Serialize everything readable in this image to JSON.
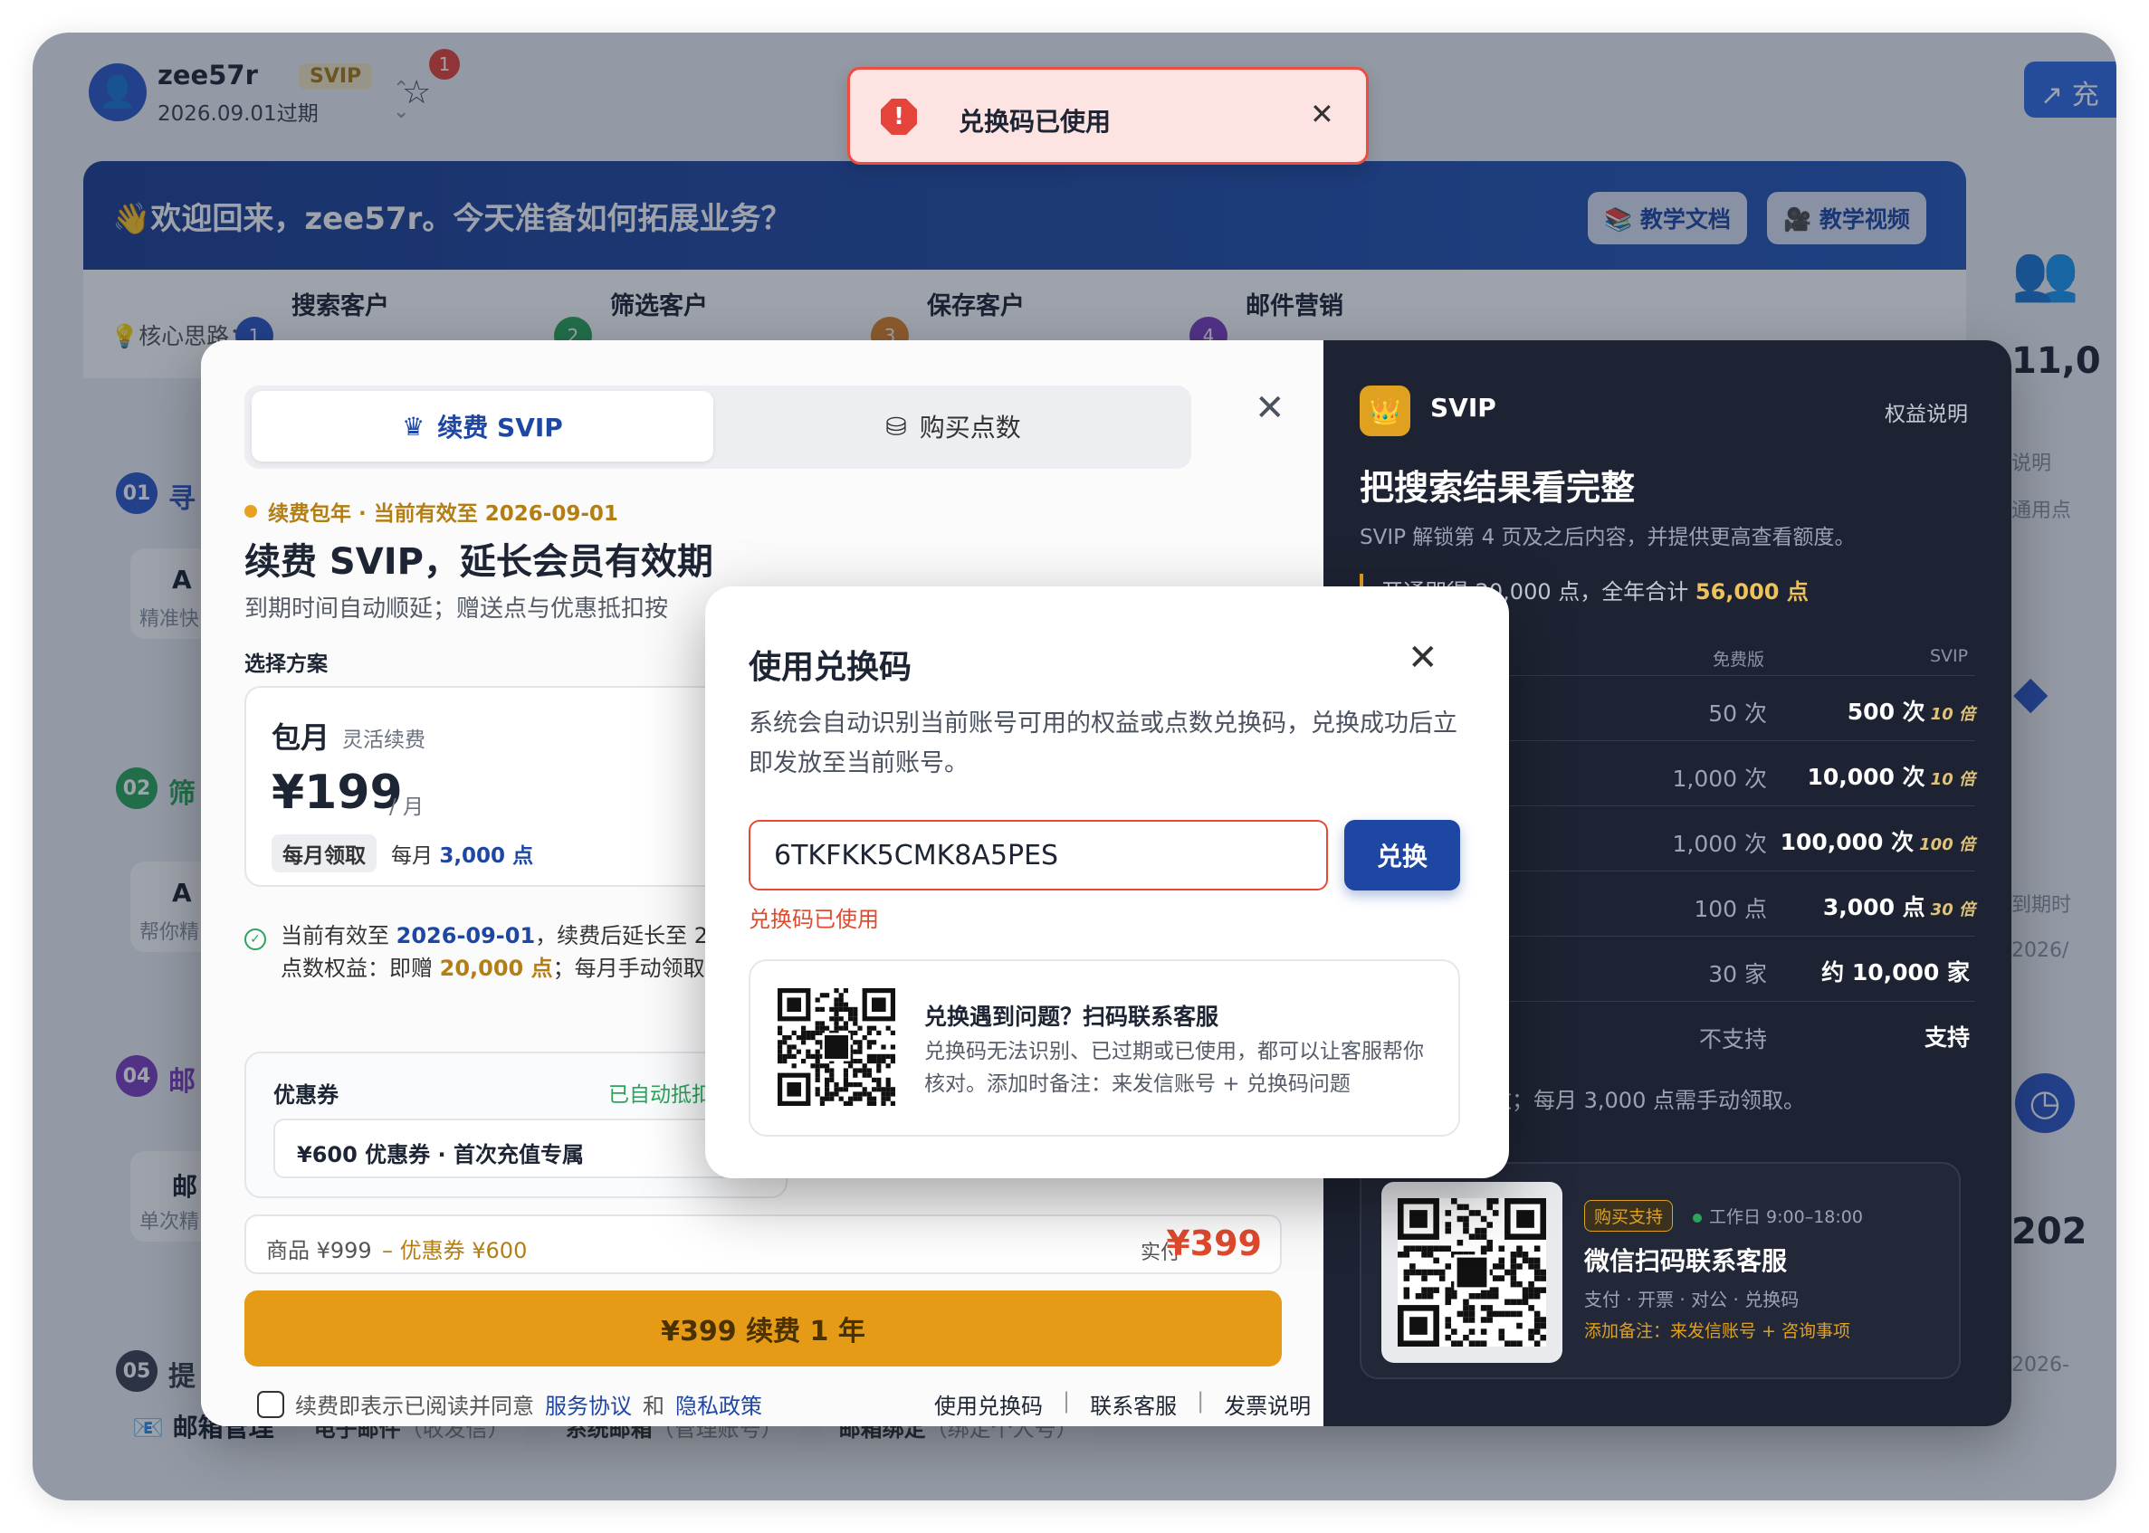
{
  "header": {
    "username": "zee57r",
    "tier": "SVIP",
    "expiry": "2026.09.01过期",
    "notification_count": "1",
    "top_button": "充"
  },
  "banner": {
    "welcome": "👋欢迎回来，zee57r。今天准备如何拓展业务？",
    "doc_button": "📚 教学文档",
    "video_button": "🎥 教学视频"
  },
  "core": {
    "label": "💡核心思路：",
    "steps": [
      {
        "num": "1",
        "label": "搜索客户",
        "color": "#2b56c9"
      },
      {
        "num": "2",
        "label": "筛选客户",
        "color": "#2aa55a"
      },
      {
        "num": "3",
        "label": "保存客户",
        "color": "#e0862a"
      },
      {
        "num": "4",
        "label": "邮件营销",
        "color": "#7a3fc2"
      }
    ]
  },
  "sections": [
    {
      "num": "01",
      "title": "寻",
      "color": "#2b56c9"
    },
    {
      "num": "02",
      "title": "筛",
      "color": "#2aa55a"
    },
    {
      "num": "04",
      "title": "邮",
      "color": "#7a3fc2"
    },
    {
      "num": "05",
      "title": "提",
      "color": "#3a4150"
    }
  ],
  "side_cards": [
    {
      "title": "A",
      "sub": "精准快"
    },
    {
      "title": "A",
      "sub": "帮你精"
    },
    {
      "title": "邮",
      "sub": "单次精"
    }
  ],
  "right_col": {
    "value1": "11,0",
    "label1": "说明",
    "label2": "通用点",
    "label3": "到期时",
    "value2": "2026/",
    "value3": "202",
    "value4": "2026-"
  },
  "mailbar": {
    "title": "📧 邮箱管理",
    "tabs": [
      {
        "label": "电子邮件",
        "sub": "（收发信）"
      },
      {
        "label": "系统邮箱",
        "sub": "（管理账号）"
      },
      {
        "label": "邮箱绑定",
        "sub": "（绑定个人号）"
      }
    ]
  },
  "renewal": {
    "tab_svip": "续费 SVIP",
    "tab_points": "购买点数",
    "status": "续费包年 · 当前有效至 2026-09-01",
    "title": "续费 SVIP，延长会员有效期",
    "subtitle": "到期时间自动顺延；赠送点与优惠抵扣按",
    "plan_label": "选择方案",
    "plan": {
      "name": "包月",
      "tag": "灵活续费",
      "price": "¥199",
      "unit": "/ 月",
      "pill": "每月领取",
      "points_prefix": "每月",
      "points": "3,000 点"
    },
    "info_line1_prefix": "当前有效至",
    "info_line1_date": "2026-09-01",
    "info_line1_suffix": "，续费后延长至 2",
    "info_line2_prefix": "点数权益：即赠",
    "info_line2_points": "20,000 点",
    "info_line2_suffix": "；每月手动领取",
    "coupon_label": "优惠券",
    "coupon_auto": "已自动抵扣",
    "coupon_value": "¥600 优惠券 · 首次充值专属",
    "goods": "商品 ¥999",
    "discount": "– 优惠券 ¥600",
    "real_label": "实付",
    "real_price": "¥399",
    "pay_button": "¥399 续费 1 年",
    "agree_text": "续费即表示已阅读并同意",
    "agree_terms": "服务协议",
    "agree_and": "和",
    "agree_privacy": "隐私政策",
    "link_redeem": "使用兑换码",
    "link_service": "联系客服",
    "link_invoice": "发票说明"
  },
  "svip_panel": {
    "brand": "SVIP",
    "rights_link": "权益说明",
    "headline": "把搜索结果看完整",
    "desc": "SVIP 解锁第 4 页及之后内容，并提供更高查看额度。",
    "total_prefix": "开通即得 20,000 点，全年合计",
    "total_value": "56,000 点",
    "col_free": "免费版",
    "col_svip": "SVIP",
    "rows": [
      {
        "free": "50 次",
        "svip": "500 次",
        "mult": "10 倍"
      },
      {
        "free": "1,000 次",
        "svip": "10,000 次",
        "mult": "10 倍"
      },
      {
        "free": "1,000 次",
        "svip": "100,000 次",
        "mult": "100 倍"
      },
      {
        "free": "100 点",
        "svip": "3,000 点",
        "mult": "30 倍"
      },
      {
        "free": "30 家",
        "svip": "约 10,000 家",
        "mult": ""
      },
      {
        "free": "不支持",
        "svip": "支持",
        "mult": ""
      }
    ],
    "note": "会开通即赠点数；每月 3,000 点需手动领取。",
    "support_badge": "购买支持",
    "support_time": "工作日 9:00–18:00",
    "support_title": "微信扫码联系客服",
    "support_sub": "支付 · 开票 · 对公 · 兑换码",
    "support_note": "添加备注：来发信账号 + 咨询事项"
  },
  "redeem": {
    "title": "使用兑换码",
    "desc": "系统会自动识别当前账号可用的权益或点数兑换码，兑换成功后立即发放至当前账号。",
    "code": "6TKFKK5CMK8A5PES",
    "button": "兑换",
    "error": "兑换码已使用",
    "help_title": "兑换遇到问题？扫码联系客服",
    "help_text": "兑换码无法识别、已过期或已使用，都可以让客服帮你核对。添加时备注：来发信账号 + 兑换码问题"
  },
  "toast": {
    "message": "兑换码已使用"
  }
}
